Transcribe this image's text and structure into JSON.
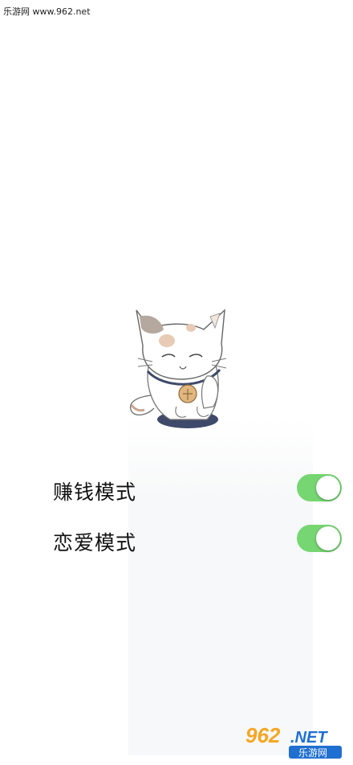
{
  "watermark": {
    "top_text": "乐游网 www.962.net",
    "logo_num": "962",
    "logo_net": ".NET",
    "logo_cn": "乐游网"
  },
  "settings": {
    "items": [
      {
        "label": "赚钱模式",
        "enabled": true
      },
      {
        "label": "恋爱模式",
        "enabled": true
      }
    ]
  },
  "colors": {
    "toggle_on": "#76d672",
    "text": "#111111"
  },
  "icons": {
    "mascot": "lucky-cat-illustration"
  }
}
